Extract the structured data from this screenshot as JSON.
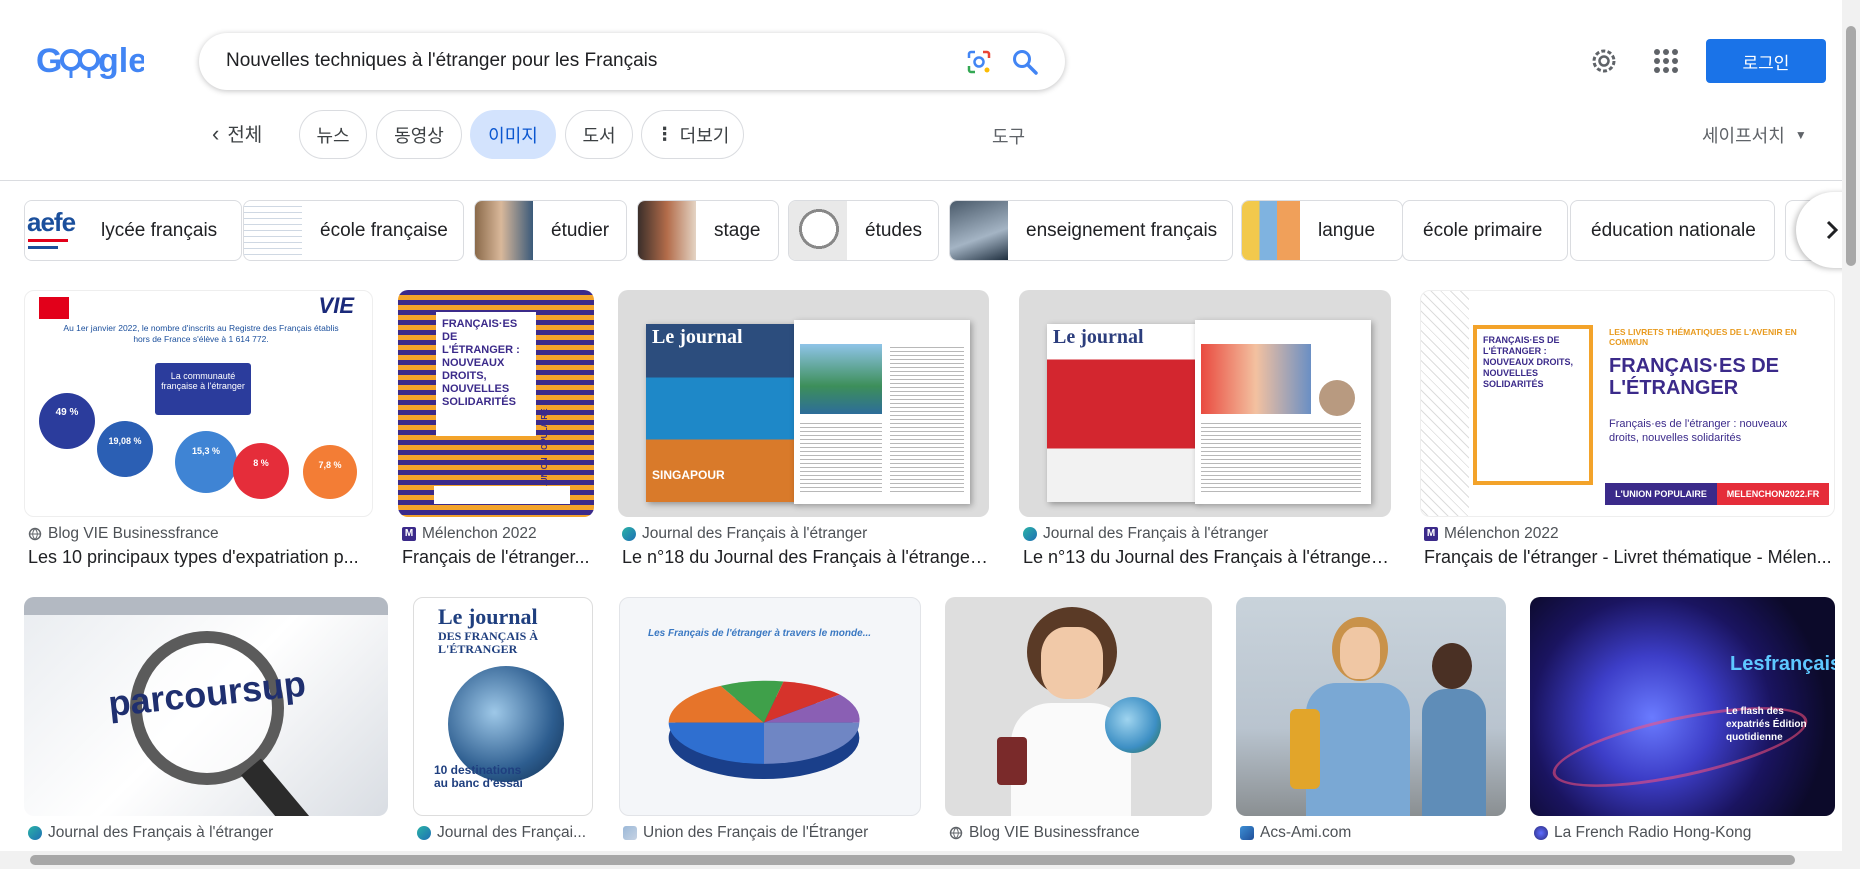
{
  "search": {
    "query": "Nouvelles techniques à l'étranger pour les Français"
  },
  "header": {
    "login_label": "로그인"
  },
  "filters": {
    "back_label": "전체",
    "tabs": [
      "뉴스",
      "동영상",
      "이미지",
      "도서",
      "더보기"
    ],
    "tools_label": "도구",
    "safesearch_label": "세이프서치"
  },
  "chips": [
    "lycée français",
    "école française",
    "étudier",
    "stage",
    "études",
    "enseignement français",
    "langue",
    "école primaire",
    "éducation nationale"
  ],
  "results": [
    {
      "source": "Blog VIE Businessfrance",
      "title": "Les 10 principaux types d'expatriation p..."
    },
    {
      "source": "Mélenchon 2022",
      "title": "Français de l'étranger..."
    },
    {
      "source": "Journal des Français à l'étranger",
      "title": "Le n°18 du Journal des Français à l'étranger ..."
    },
    {
      "source": "Journal des Français à l'étranger",
      "title": "Le n°13 du Journal des Français à l'étranger ..."
    },
    {
      "source": "Mélenchon 2022",
      "title": "Français de l'étranger - Livret thématique - Mélen..."
    },
    {
      "source": "Journal des Français à l'étranger",
      "title": ""
    },
    {
      "source": "Journal des Françai...",
      "title": ""
    },
    {
      "source": "Union des Français de l'Étranger",
      "title": ""
    },
    {
      "source": "Blog VIE Businessfrance",
      "title": ""
    },
    {
      "source": "Acs-Ami.com",
      "title": ""
    },
    {
      "source": "La French Radio Hong-Kong",
      "title": ""
    }
  ],
  "image_text": {
    "aefe": "aefe",
    "vie_stat": "Au 1er janvier 2022, le nombre d'inscrits au Registre des Français établis hors de France s'élève à 1 614 772.",
    "vie_box": "La communauté française à l'étranger",
    "vie_bubbles": [
      "49 %",
      "19,08 %",
      "15,3 %",
      "8 %",
      "7,8 %"
    ],
    "booklet_title": "FRANÇAIS·ES DE L'ÉTRANGER : NOUVEAUX DROITS, NOUVELLES SOLIDARITÉS",
    "booklet_side": "L'UNION POPULAIRE",
    "journal_title": "Le journal",
    "journal_sub": "DES FRANÇAIS À L'ÉTRANGER",
    "singapour": "SINGAPOUR",
    "melen_small": "LES LIVRETS THÉMATIQUES DE L'AVENIR EN COMMUN",
    "melen_big": "FRANÇAIS·ES DE L'ÉTRANGER",
    "melen_sub": "Français·es de l'étranger : nouveaux droits, nouvelles solidarités",
    "melen_footer_left": "L'UNION POPULAIRE",
    "melen_footer_right": "MELENCHON2022.FR",
    "parcoursup": "parcoursup",
    "dossier": "10 destinations au banc d'essai",
    "pie_title": "Les Français de l'étranger à travers le monde...",
    "press_title": "Lesfrançais.press",
    "press_sub": "Le flash des expatriés Édition quotidienne"
  },
  "colors": {
    "accent": "#1a73e8",
    "active_tab_bg": "#d3e3fd"
  }
}
